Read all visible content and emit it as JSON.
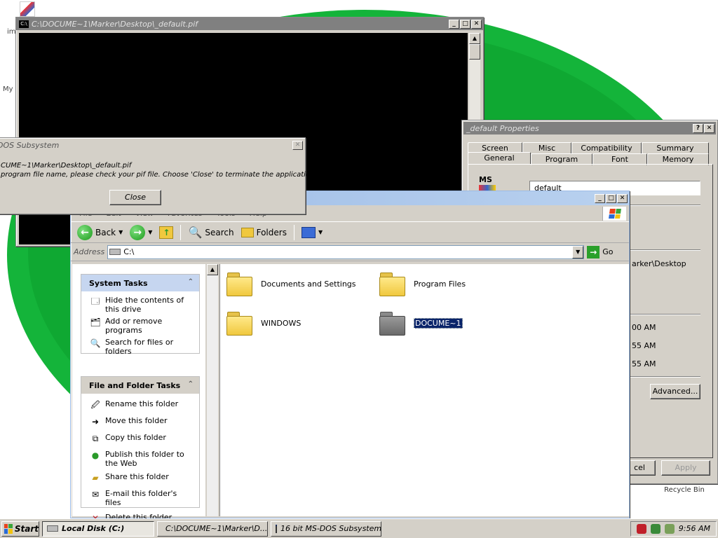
{
  "desktop": {
    "icon_label_1": "im",
    "icon_label_2": "My",
    "recycle_bin": "Recycle Bin"
  },
  "console": {
    "title": "C:\\DOCUME~1\\Marker\\Desktop\\_default.pif"
  },
  "dos_dialog": {
    "title": "DOS Subsystem",
    "line1": "CUME~1\\Marker\\Desktop\\_default.pif",
    "line2": "program file name, please check your pif file. Choose 'Close' to terminate the application.",
    "close_label": "Close"
  },
  "properties": {
    "title": "_default Properties",
    "tabs_row1": [
      "Screen",
      "Misc",
      "Compatibility",
      "Summary"
    ],
    "tabs_row2": [
      "General",
      "Program",
      "Font",
      "Memory"
    ],
    "active_tab": "General",
    "logo_text": "MS",
    "name_value": "default",
    "location_partial": "arker\\Desktop",
    "time1": "00 AM",
    "time2": "55 AM",
    "time3": "55 AM",
    "advanced_label": "Advanced...",
    "cancel_partial": "cel",
    "apply_label": "Apply"
  },
  "explorer": {
    "menu": [
      "File",
      "Edit",
      "View",
      "Favorites",
      "Tools",
      "Help"
    ],
    "toolbar": {
      "back": "Back",
      "search": "Search",
      "folders": "Folders"
    },
    "address_label": "Address",
    "address_value": "C:\\",
    "go_label": "Go",
    "system_tasks": {
      "title": "System Tasks",
      "items": [
        "Hide the contents of this drive",
        "Add or remove programs",
        "Search for files or folders"
      ]
    },
    "file_tasks": {
      "title": "File and Folder Tasks",
      "items": [
        "Rename this folder",
        "Move this folder",
        "Copy this folder",
        "Publish this folder to the Web",
        "Share this folder",
        "E-mail this folder's files",
        "Delete this folder"
      ]
    },
    "folders": [
      "Documents and Settings",
      "Program Files",
      "WINDOWS",
      "DOCUME~1"
    ]
  },
  "taskbar": {
    "start": "Start",
    "buttons": [
      "Local Disk (C:)",
      "C:\\DOCUME~1\\Marker\\D...",
      "16 bit MS-DOS Subsystem"
    ],
    "clock": "9:56 AM"
  },
  "colors": {
    "desktop_green": "#14b43a",
    "selection_blue": "#0a246a",
    "titlebar_blue": "#9cbbe6"
  }
}
